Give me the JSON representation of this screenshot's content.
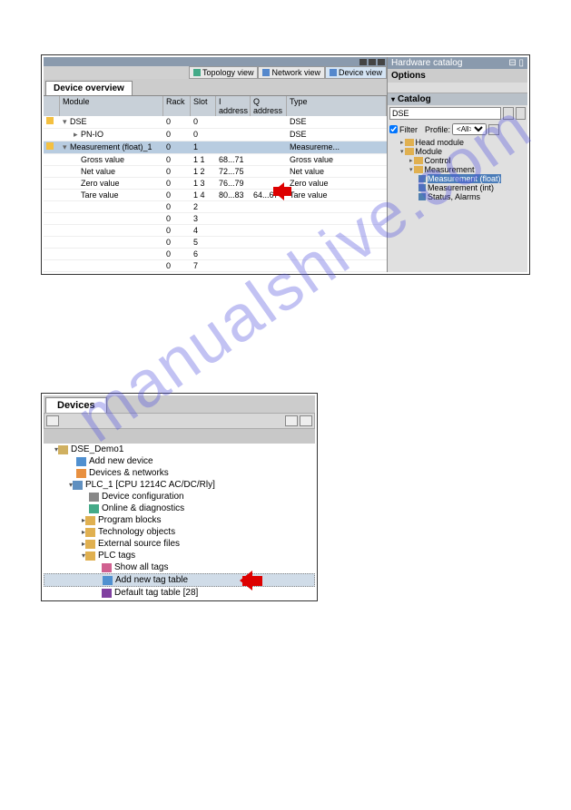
{
  "screenshot1": {
    "views": {
      "topology": "Topology view",
      "network": "Network view",
      "device": "Device view"
    },
    "deviceOverviewTab": "Device overview",
    "columns": {
      "module": "Module",
      "rack": "Rack",
      "slot": "Slot",
      "iaddr": "I address",
      "qaddr": "Q address",
      "type": "Type"
    },
    "rows": [
      {
        "module": "DSE",
        "rack": "0",
        "slot": "0",
        "iaddr": "",
        "qaddr": "",
        "type": "DSE",
        "indent": 0,
        "exp": true
      },
      {
        "module": "PN-IO",
        "rack": "0",
        "slot": "0",
        "iaddr": "",
        "qaddr": "",
        "type": "DSE",
        "indent": 1,
        "exp": false
      },
      {
        "module": "Measurement (float)_1",
        "rack": "0",
        "slot": "1",
        "iaddr": "",
        "qaddr": "",
        "type": "Measureme...",
        "indent": 0,
        "sel": true,
        "exp": true
      },
      {
        "module": "Gross value",
        "rack": "0",
        "slot": "1 1",
        "iaddr": "68...71",
        "qaddr": "",
        "type": "Gross value",
        "indent": 1
      },
      {
        "module": "Net value",
        "rack": "0",
        "slot": "1 2",
        "iaddr": "72...75",
        "qaddr": "",
        "type": "Net value",
        "indent": 1
      },
      {
        "module": "Zero value",
        "rack": "0",
        "slot": "1 3",
        "iaddr": "76...79",
        "qaddr": "",
        "type": "Zero value",
        "indent": 1
      },
      {
        "module": "Tare value",
        "rack": "0",
        "slot": "1 4",
        "iaddr": "80...83",
        "qaddr": "64...67",
        "type": "Tare value",
        "indent": 1,
        "arrow": true
      }
    ],
    "emptyRows": [
      {
        "rack": "0",
        "slot": "2"
      },
      {
        "rack": "0",
        "slot": "3"
      },
      {
        "rack": "0",
        "slot": "4"
      },
      {
        "rack": "0",
        "slot": "5"
      },
      {
        "rack": "0",
        "slot": "6"
      },
      {
        "rack": "0",
        "slot": "7"
      }
    ],
    "catalog": {
      "title": "Hardware catalog",
      "options": "Options",
      "section": "Catalog",
      "searchValue": "DSE",
      "filterLabel": "Filter",
      "profileLabel": "Profile:",
      "profileValue": "<All>",
      "tree": [
        {
          "label": "Head module",
          "kind": "folder",
          "ind": 1,
          "exp": false
        },
        {
          "label": "Module",
          "kind": "folder",
          "ind": 1,
          "exp": true
        },
        {
          "label": "Control",
          "kind": "folder",
          "ind": 2,
          "exp": false
        },
        {
          "label": "Measurement",
          "kind": "folder",
          "ind": 2,
          "exp": true
        },
        {
          "label": "Measurement (float)",
          "kind": "device",
          "ind": 3,
          "sel": true
        },
        {
          "label": "Measurement (int)",
          "kind": "device",
          "ind": 3
        },
        {
          "label": "Status, Alarms",
          "kind": "device",
          "ind": 3
        }
      ]
    }
  },
  "screenshot2": {
    "tab": "Devices",
    "tree": [
      {
        "label": "DSE_Demo1",
        "icon": "ic-proj",
        "ind": 0,
        "exp": true
      },
      {
        "label": "Add new device",
        "icon": "ic-add",
        "ind": 1
      },
      {
        "label": "Devices & networks",
        "icon": "ic-net",
        "ind": 1
      },
      {
        "label": "PLC_1 [CPU 1214C AC/DC/Rly]",
        "icon": "ic-plc",
        "ind": 1,
        "exp": true
      },
      {
        "label": "Device configuration",
        "icon": "ic-cfg",
        "ind": 2
      },
      {
        "label": "Online & diagnostics",
        "icon": "ic-diag",
        "ind": 2
      },
      {
        "label": "Program blocks",
        "icon": "ic-fold",
        "ind": 2,
        "exp": false
      },
      {
        "label": "Technology objects",
        "icon": "ic-fold",
        "ind": 2,
        "exp": false
      },
      {
        "label": "External source files",
        "icon": "ic-fold",
        "ind": 2,
        "exp": false
      },
      {
        "label": "PLC tags",
        "icon": "ic-fold",
        "ind": 2,
        "exp": true
      },
      {
        "label": "Show all tags",
        "icon": "ic-tags",
        "ind": 3
      },
      {
        "label": "Add new tag table",
        "icon": "ic-add",
        "ind": 3,
        "sel": true,
        "arrow": true
      },
      {
        "label": "Default tag table [28]",
        "icon": "ic-table",
        "ind": 3
      }
    ]
  },
  "watermark": "manualshive.com"
}
